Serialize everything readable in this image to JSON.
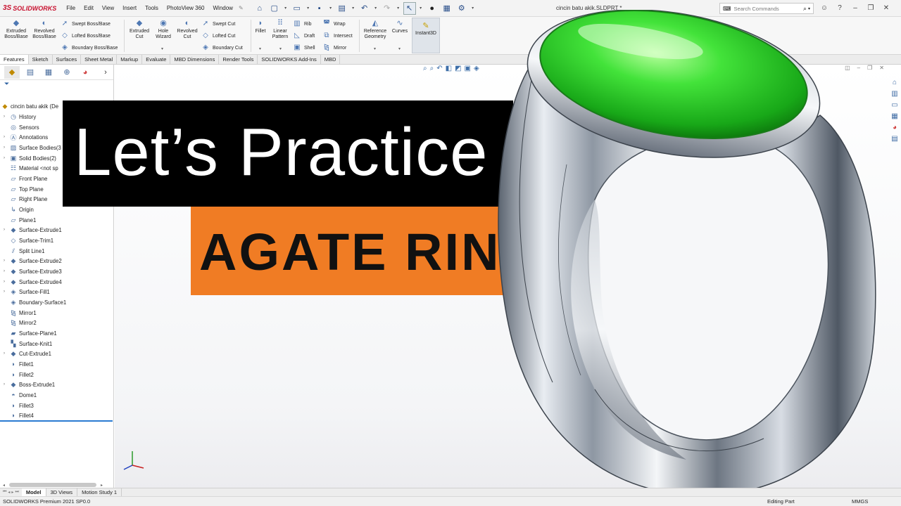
{
  "app": {
    "brand": "SOLIDWORKS",
    "document_title": "cincin batu akik.SLDPRT *"
  },
  "menu": [
    "File",
    "Edit",
    "View",
    "Insert",
    "Tools",
    "PhotoView 360",
    "Window"
  ],
  "search": {
    "placeholder": "Search Commands"
  },
  "commands": {
    "extruded_boss": "Extruded Boss/Base",
    "revolved_boss": "Revolved Boss/Base",
    "swept_boss": "Swept Boss/Base",
    "lofted_boss": "Lofted Boss/Base",
    "boundary_boss": "Boundary Boss/Base",
    "extruded_cut": "Extruded Cut",
    "hole_wizard": "Hole Wizard",
    "revolved_cut": "Revolved Cut",
    "swept_cut": "Swept Cut",
    "lofted_cut": "Lofted Cut",
    "boundary_cut": "Boundary Cut",
    "fillet": "Fillet",
    "linear_pattern": "Linear Pattern",
    "rib": "Rib",
    "draft": "Draft",
    "shell": "Shell",
    "wrap": "Wrap",
    "intersect": "Intersect",
    "mirror": "Mirror",
    "reference_geometry": "Reference Geometry",
    "curves": "Curves",
    "instant3d": "Instant3D"
  },
  "tabs": [
    "Features",
    "Sketch",
    "Surfaces",
    "Sheet Metal",
    "Markup",
    "Evaluate",
    "MBD Dimensions",
    "Render Tools",
    "SOLIDWORKS Add-Ins",
    "MBD"
  ],
  "tree": {
    "root": "cincin batu akik (De",
    "items": [
      "History",
      "Sensors",
      "Annotations",
      "Surface Bodies(3",
      "Solid Bodies(2)",
      "Material <not sp",
      "Front Plane",
      "Top Plane",
      "Right Plane",
      "Origin",
      "Plane1",
      "Surface-Extrude1",
      "Surface-Trim1",
      "Split Line1",
      "Surface-Extrude2",
      "Surface-Extrude3",
      "Surface-Extrude4",
      "Surface-Fill1",
      "Boundary-Surface1",
      "Mirror1",
      "Mirror2",
      "Surface-Plane1",
      "Surface-Knit1",
      "Cut-Extrude1",
      "Fillet1",
      "Fillet2",
      "Boss-Extrude1",
      "Dome1",
      "Fillet3",
      "Fillet4"
    ]
  },
  "overlay": {
    "line1": "Let’s Practice",
    "line2": "AGATE RING"
  },
  "bottom_tabs": [
    "Model",
    "3D Views",
    "Motion Study 1"
  ],
  "status": {
    "version": "SOLIDWORKS Premium 2021 SP0.0",
    "mode": "Editing Part",
    "units": "MMGS"
  },
  "colors": {
    "brand_red": "#c8102e",
    "banner_black": "#000000",
    "banner_orange": "#f07c24",
    "stone_green": "#2fd12f"
  }
}
